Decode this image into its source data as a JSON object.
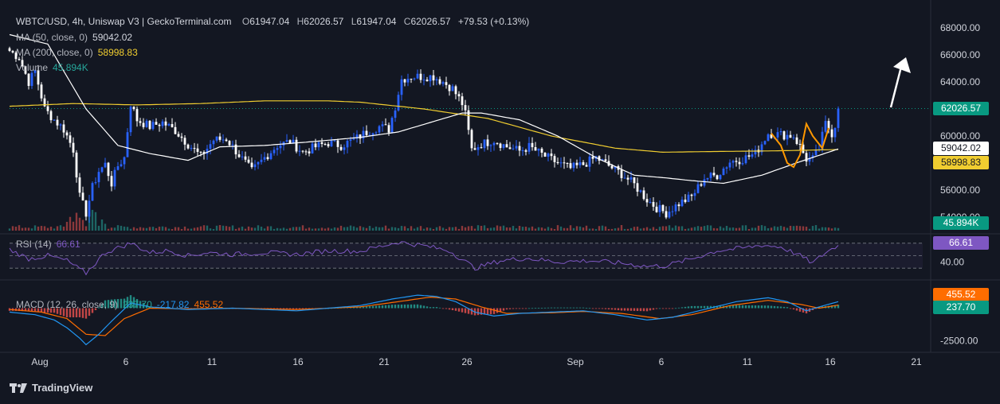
{
  "header": {
    "symbol": "WBTC/USD, 4h, Uniswap V3 | GeckoTerminal.com",
    "open_label": "O",
    "open": "61947.04",
    "high_label": "H",
    "high": "62026.57",
    "low_label": "L",
    "low": "61947.04",
    "close_label": "C",
    "close": "62026.57",
    "change": "+79.53 (+0.13%)"
  },
  "indicators": {
    "ma50": {
      "label": "MA (50, close, 0)",
      "value": "59042.02"
    },
    "ma200": {
      "label": "MA (200, close, 0)",
      "value": "58998.83"
    },
    "volume": {
      "label": "Volume",
      "value": "45.894K"
    },
    "rsi": {
      "label": "RSI (14)",
      "value": "66.61"
    },
    "macd": {
      "label": "MACD (12, 26, close, 9)",
      "macd": "237.70",
      "signal": "-217.82",
      "hist": "455.52"
    }
  },
  "branding": {
    "logo_text": "TradingView"
  },
  "colors": {
    "up": "#2962ff",
    "down": "#ffffff",
    "ma50": "#ffffff",
    "ma200": "#f0cd30",
    "rsi": "#7e57c2",
    "macd": "#2196f3",
    "signal": "#ff6d00",
    "hist_up": "#26a69a",
    "hist_down": "#ef5350",
    "price_badge": "#089981",
    "pattern": "#ff9800",
    "arrow": "#ffffff"
  },
  "chart_data": [
    {
      "type": "candlestick",
      "title": "WBTC/USD, 4h, Uniswap V3",
      "y_axis_ticks": [
        "68000.00",
        "66000.00",
        "64000.00",
        "62000.00",
        "60000.00",
        "58000.00",
        "56000.00",
        "54000.00"
      ],
      "x_axis_ticks": [
        "Aug",
        "6",
        "11",
        "16",
        "21",
        "26",
        "Sep",
        "6",
        "11",
        "16",
        "21"
      ],
      "ylim": [
        53000,
        69000
      ],
      "price_label": "62026.57",
      "close_series_anchors": [
        [
          0,
          66300
        ],
        [
          3,
          65800
        ],
        [
          6,
          64000
        ],
        [
          8,
          64800
        ],
        [
          11,
          62000
        ],
        [
          14,
          61200
        ],
        [
          17,
          60500
        ],
        [
          20,
          59000
        ],
        [
          22,
          55500
        ],
        [
          24,
          54300
        ],
        [
          26,
          56200
        ],
        [
          28,
          57400
        ],
        [
          30,
          57900
        ],
        [
          32,
          56500
        ],
        [
          34,
          57800
        ],
        [
          36,
          58400
        ],
        [
          38,
          62400
        ],
        [
          40,
          61200
        ],
        [
          44,
          60700
        ],
        [
          48,
          61000
        ],
        [
          52,
          60400
        ],
        [
          56,
          59400
        ],
        [
          60,
          58500
        ],
        [
          64,
          59700
        ],
        [
          68,
          59800
        ],
        [
          72,
          58600
        ],
        [
          76,
          57400
        ],
        [
          80,
          58400
        ],
        [
          84,
          59300
        ],
        [
          88,
          59600
        ],
        [
          92,
          58800
        ],
        [
          96,
          59200
        ],
        [
          100,
          59500
        ],
        [
          104,
          59300
        ],
        [
          108,
          59700
        ],
        [
          112,
          60300
        ],
        [
          116,
          60700
        ],
        [
          119,
          60500
        ],
        [
          121,
          62200
        ],
        [
          123,
          64200
        ],
        [
          126,
          64400
        ],
        [
          130,
          64400
        ],
        [
          133,
          64400
        ],
        [
          136,
          64000
        ],
        [
          139,
          63500
        ],
        [
          142,
          62400
        ],
        [
          143,
          61600
        ],
        [
          145,
          59000
        ],
        [
          148,
          59400
        ],
        [
          152,
          59700
        ],
        [
          156,
          59200
        ],
        [
          160,
          58900
        ],
        [
          163,
          59200
        ],
        [
          168,
          58500
        ],
        [
          172,
          58000
        ],
        [
          176,
          57600
        ],
        [
          180,
          57900
        ],
        [
          184,
          58400
        ],
        [
          188,
          57800
        ],
        [
          192,
          57200
        ],
        [
          196,
          56400
        ],
        [
          200,
          55300
        ],
        [
          203,
          54700
        ],
        [
          206,
          54300
        ],
        [
          210,
          55000
        ],
        [
          214,
          55500
        ],
        [
          218,
          56900
        ],
        [
          222,
          57100
        ],
        [
          226,
          58100
        ],
        [
          230,
          58300
        ],
        [
          234,
          58700
        ],
        [
          238,
          60200
        ],
        [
          242,
          60100
        ],
        [
          246,
          60000
        ],
        [
          248,
          59200
        ],
        [
          250,
          58300
        ],
        [
          252,
          58300
        ],
        [
          254,
          59100
        ],
        [
          256,
          60900
        ],
        [
          258,
          60200
        ],
        [
          259,
          60800
        ],
        [
          260,
          62026.57
        ]
      ],
      "ma50_anchors": [
        [
          0,
          67500
        ],
        [
          12,
          66800
        ],
        [
          24,
          62000
        ],
        [
          34,
          59300
        ],
        [
          44,
          58700
        ],
        [
          56,
          58200
        ],
        [
          66,
          59200
        ],
        [
          80,
          59300
        ],
        [
          96,
          59600
        ],
        [
          110,
          59900
        ],
        [
          122,
          60300
        ],
        [
          132,
          61000
        ],
        [
          142,
          61700
        ],
        [
          148,
          61700
        ],
        [
          160,
          61200
        ],
        [
          172,
          60000
        ],
        [
          184,
          58400
        ],
        [
          196,
          57100
        ],
        [
          206,
          56900
        ],
        [
          214,
          56700
        ],
        [
          224,
          56500
        ],
        [
          236,
          57100
        ],
        [
          248,
          58100
        ],
        [
          260,
          59042.02
        ]
      ],
      "ma200_anchors": [
        [
          0,
          62200
        ],
        [
          20,
          62400
        ],
        [
          40,
          62300
        ],
        [
          60,
          62400
        ],
        [
          80,
          62600
        ],
        [
          100,
          62600
        ],
        [
          110,
          62500
        ],
        [
          130,
          62000
        ],
        [
          150,
          61300
        ],
        [
          170,
          60000
        ],
        [
          190,
          59100
        ],
        [
          205,
          58800
        ],
        [
          220,
          58850
        ],
        [
          240,
          58900
        ],
        [
          260,
          58998.83
        ]
      ],
      "volume_last": "45.894K"
    },
    {
      "type": "line",
      "title": "RSI (14)",
      "y_axis_ticks": [
        "40.00"
      ],
      "ylim": [
        20,
        80
      ],
      "bands": [
        70,
        50,
        30
      ],
      "value_label": "66.61",
      "anchors": [
        [
          0,
          60
        ],
        [
          6,
          45
        ],
        [
          12,
          50
        ],
        [
          18,
          42
        ],
        [
          22,
          28
        ],
        [
          24,
          22
        ],
        [
          30,
          55
        ],
        [
          38,
          70
        ],
        [
          44,
          55
        ],
        [
          50,
          58
        ],
        [
          56,
          50
        ],
        [
          62,
          55
        ],
        [
          70,
          52
        ],
        [
          80,
          55
        ],
        [
          90,
          52
        ],
        [
          100,
          58
        ],
        [
          110,
          57
        ],
        [
          122,
          72
        ],
        [
          130,
          66
        ],
        [
          138,
          58
        ],
        [
          146,
          30
        ],
        [
          154,
          42
        ],
        [
          162,
          46
        ],
        [
          172,
          40
        ],
        [
          182,
          42
        ],
        [
          192,
          38
        ],
        [
          200,
          33
        ],
        [
          206,
          34
        ],
        [
          214,
          45
        ],
        [
          222,
          58
        ],
        [
          230,
          62
        ],
        [
          236,
          67
        ],
        [
          242,
          64
        ],
        [
          248,
          50
        ],
        [
          252,
          38
        ],
        [
          256,
          55
        ],
        [
          260,
          66.61
        ]
      ]
    },
    {
      "type": "macd",
      "title": "MACD (12, 26, close, 9)",
      "y_axis_ticks": [
        "-2500.00"
      ],
      "ylim": [
        -3200,
        1800
      ],
      "value_labels": {
        "macd": "237.70",
        "hist": "455.52"
      },
      "macd_anchors": [
        [
          0,
          -300
        ],
        [
          8,
          -500
        ],
        [
          14,
          -900
        ],
        [
          18,
          -1500
        ],
        [
          22,
          -2300
        ],
        [
          24,
          -2800
        ],
        [
          28,
          -2000
        ],
        [
          32,
          -1000
        ],
        [
          38,
          400
        ],
        [
          44,
          100
        ],
        [
          56,
          -100
        ],
        [
          70,
          0
        ],
        [
          90,
          -200
        ],
        [
          110,
          200
        ],
        [
          120,
          700
        ],
        [
          128,
          1000
        ],
        [
          134,
          900
        ],
        [
          140,
          500
        ],
        [
          146,
          -300
        ],
        [
          152,
          -600
        ],
        [
          160,
          -400
        ],
        [
          170,
          -300
        ],
        [
          180,
          -200
        ],
        [
          190,
          -500
        ],
        [
          200,
          -900
        ],
        [
          208,
          -700
        ],
        [
          218,
          -100
        ],
        [
          228,
          500
        ],
        [
          238,
          800
        ],
        [
          244,
          500
        ],
        [
          250,
          -200
        ],
        [
          254,
          100
        ],
        [
          260,
          500
        ]
      ],
      "signal_anchors": [
        [
          0,
          -100
        ],
        [
          10,
          -300
        ],
        [
          18,
          -800
        ],
        [
          24,
          -2000
        ],
        [
          30,
          -2100
        ],
        [
          36,
          -800
        ],
        [
          44,
          0
        ],
        [
          56,
          -50
        ],
        [
          70,
          0
        ],
        [
          90,
          -100
        ],
        [
          110,
          100
        ],
        [
          122,
          500
        ],
        [
          132,
          850
        ],
        [
          140,
          700
        ],
        [
          148,
          100
        ],
        [
          156,
          -400
        ],
        [
          170,
          -350
        ],
        [
          180,
          -250
        ],
        [
          192,
          -400
        ],
        [
          204,
          -800
        ],
        [
          214,
          -500
        ],
        [
          226,
          200
        ],
        [
          238,
          600
        ],
        [
          248,
          300
        ],
        [
          254,
          0
        ],
        [
          260,
          237.7
        ]
      ]
    }
  ]
}
